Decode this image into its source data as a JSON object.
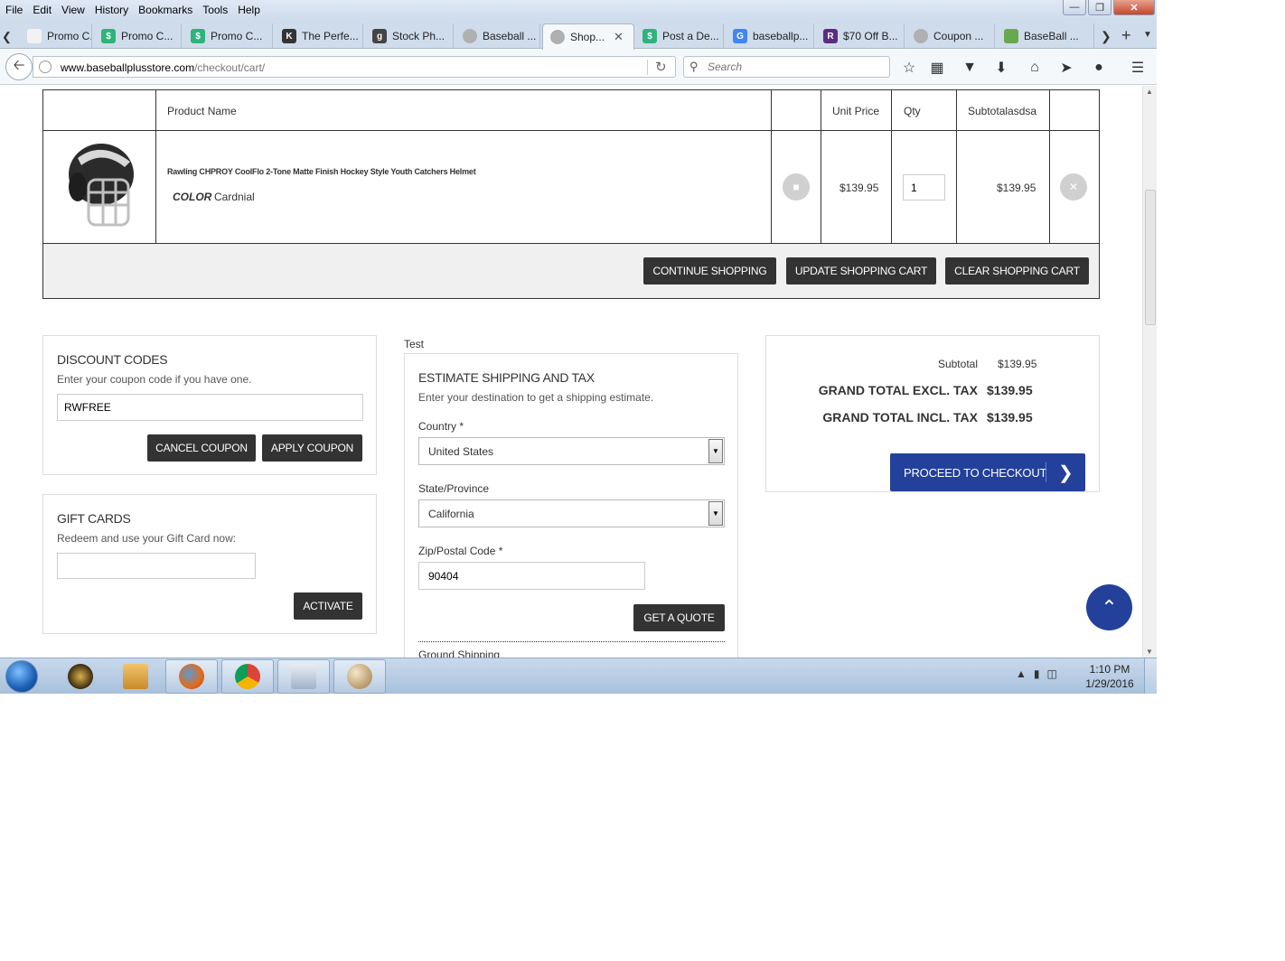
{
  "menubar": {
    "items": [
      "File",
      "Edit",
      "View",
      "History",
      "Bookmarks",
      "Tools",
      "Help"
    ]
  },
  "window_controls": {
    "minimize": "—",
    "restore": "❐",
    "close": "✕"
  },
  "tabs": [
    {
      "label": "Promo C...",
      "icon": "coupon-tag-icon",
      "color": "#f2f2f2"
    },
    {
      "label": "Promo C...",
      "icon": "coupon-shield-icon",
      "color": "#2fb37a"
    },
    {
      "label": "Promo C...",
      "icon": "coupon-shield-icon",
      "color": "#2fb37a"
    },
    {
      "label": "The Perfe...",
      "icon": "kj-logo-icon",
      "color": "#333333"
    },
    {
      "label": "Stock Ph...",
      "icon": "g-logo-icon",
      "color": "#444444"
    },
    {
      "label": "Baseball ...",
      "icon": "baseball-icon",
      "color": "#b0b0b0"
    },
    {
      "label": "Shop...",
      "icon": "baseball-icon",
      "color": "#b0b0b0",
      "active": true
    },
    {
      "label": "Post a De...",
      "icon": "coupon-shield-icon",
      "color": "#2fb37a"
    },
    {
      "label": "baseballp...",
      "icon": "google-icon",
      "color": "#4285f4"
    },
    {
      "label": "$70 Off B...",
      "icon": "retailmenot-icon",
      "color": "#5a2d82"
    },
    {
      "label": "Coupon ...",
      "icon": "baseball-icon",
      "color": "#b0b0b0"
    },
    {
      "label": "BaseBall ...",
      "icon": "price-tag-icon",
      "color": "#6aa84f"
    }
  ],
  "navbar": {
    "url_domain": "www.baseballplusstore.com",
    "url_path": "/checkout/cart/",
    "search_placeholder": "Search"
  },
  "cart": {
    "headers": {
      "product_name": "Product Name",
      "unit_price": "Unit Price",
      "qty": "Qty",
      "subtotal": "Subtotalasdsa"
    },
    "item": {
      "name": "Rawling CHPROY CoolFlo 2-Tone Matte Finish Hockey Style Youth Catchers Helmet",
      "color_label": "COLOR",
      "color_value": "Cardnial",
      "unit_price": "$139.95",
      "qty": "1",
      "subtotal": "$139.95"
    },
    "buttons": {
      "continue": "CONTINUE SHOPPING",
      "update": "UPDATE SHOPPING CART",
      "clear": "CLEAR SHOPPING CART"
    }
  },
  "discount": {
    "title": "DISCOUNT CODES",
    "subtitle": "Enter your coupon code if you have one.",
    "code": "RWFREE",
    "cancel": "CANCEL COUPON",
    "apply": "APPLY COUPON"
  },
  "giftcards": {
    "title": "GIFT CARDS",
    "subtitle": "Redeem and use your Gift Card now:",
    "value": "",
    "activate": "ACTIVATE"
  },
  "shipping": {
    "test_label": "Test",
    "title": "ESTIMATE SHIPPING AND TAX",
    "subtitle": "Enter your destination to get a shipping estimate.",
    "country_label": "Country",
    "country_value": "United States",
    "state_label": "State/Province",
    "state_value": "California",
    "zip_label": "Zip/Postal Code",
    "zip_value": "90404",
    "quote_button": "GET A QUOTE",
    "ground": "Ground Shipping",
    "required_mark": "*"
  },
  "totals": {
    "subtotal_label": "Subtotal",
    "subtotal_value": "$139.95",
    "excl_label": "GRAND TOTAL EXCL. TAX",
    "excl_value": "$139.95",
    "incl_label": "GRAND TOTAL INCL. TAX",
    "incl_value": "$139.95",
    "checkout": "PROCEED TO CHECKOUT"
  },
  "taskbar": {
    "apps": [
      "start-orb-icon",
      "warcraft-icon",
      "folder-icon",
      "firefox-icon",
      "chrome-icon",
      "calculator-icon",
      "paint-icon"
    ],
    "time": "1:10 PM",
    "date": "1/29/2016"
  },
  "colors": {
    "accent_blue": "#23409a",
    "dark_button": "#333333",
    "border": "#333333"
  }
}
